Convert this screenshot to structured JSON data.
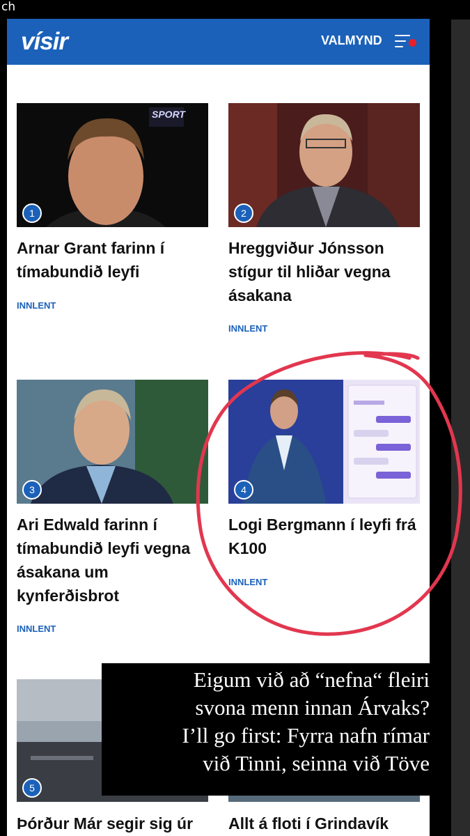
{
  "screen": {
    "top_label": "ch"
  },
  "header": {
    "logo": "vísir",
    "menu_label": "VALMYND"
  },
  "articles": [
    {
      "rank": "1",
      "title": "Arnar Grant farinn í tímabundið leyfi",
      "category": "INNLENT",
      "image_text": "SPORT"
    },
    {
      "rank": "2",
      "title": "Hreggviður Jónsson stígur til hliðar vegna ásakana",
      "category": "INNLENT"
    },
    {
      "rank": "3",
      "title": "Ari Edwald farinn í tímabundið leyfi vegna ásakana um kynferðisbrot",
      "category": "INNLENT"
    },
    {
      "rank": "4",
      "title": "Logi Bergmann í leyfi frá K100",
      "category": "INNLENT"
    },
    {
      "rank": "5",
      "title": "Þórður Már segir sig úr"
    },
    {
      "title": "Allt á floti í Grindavík"
    }
  ],
  "caption": {
    "lines": [
      "Eigum við að “nefna“ fleiri",
      "svona menn innan Árvaks?",
      "I’ll go first: Fyrra nafn rímar",
      "við Tinni, seinna við Töve"
    ]
  },
  "colors": {
    "brand": "#1b61b9",
    "annotation": "#e2374f",
    "menu_dot": "#e8202a"
  }
}
